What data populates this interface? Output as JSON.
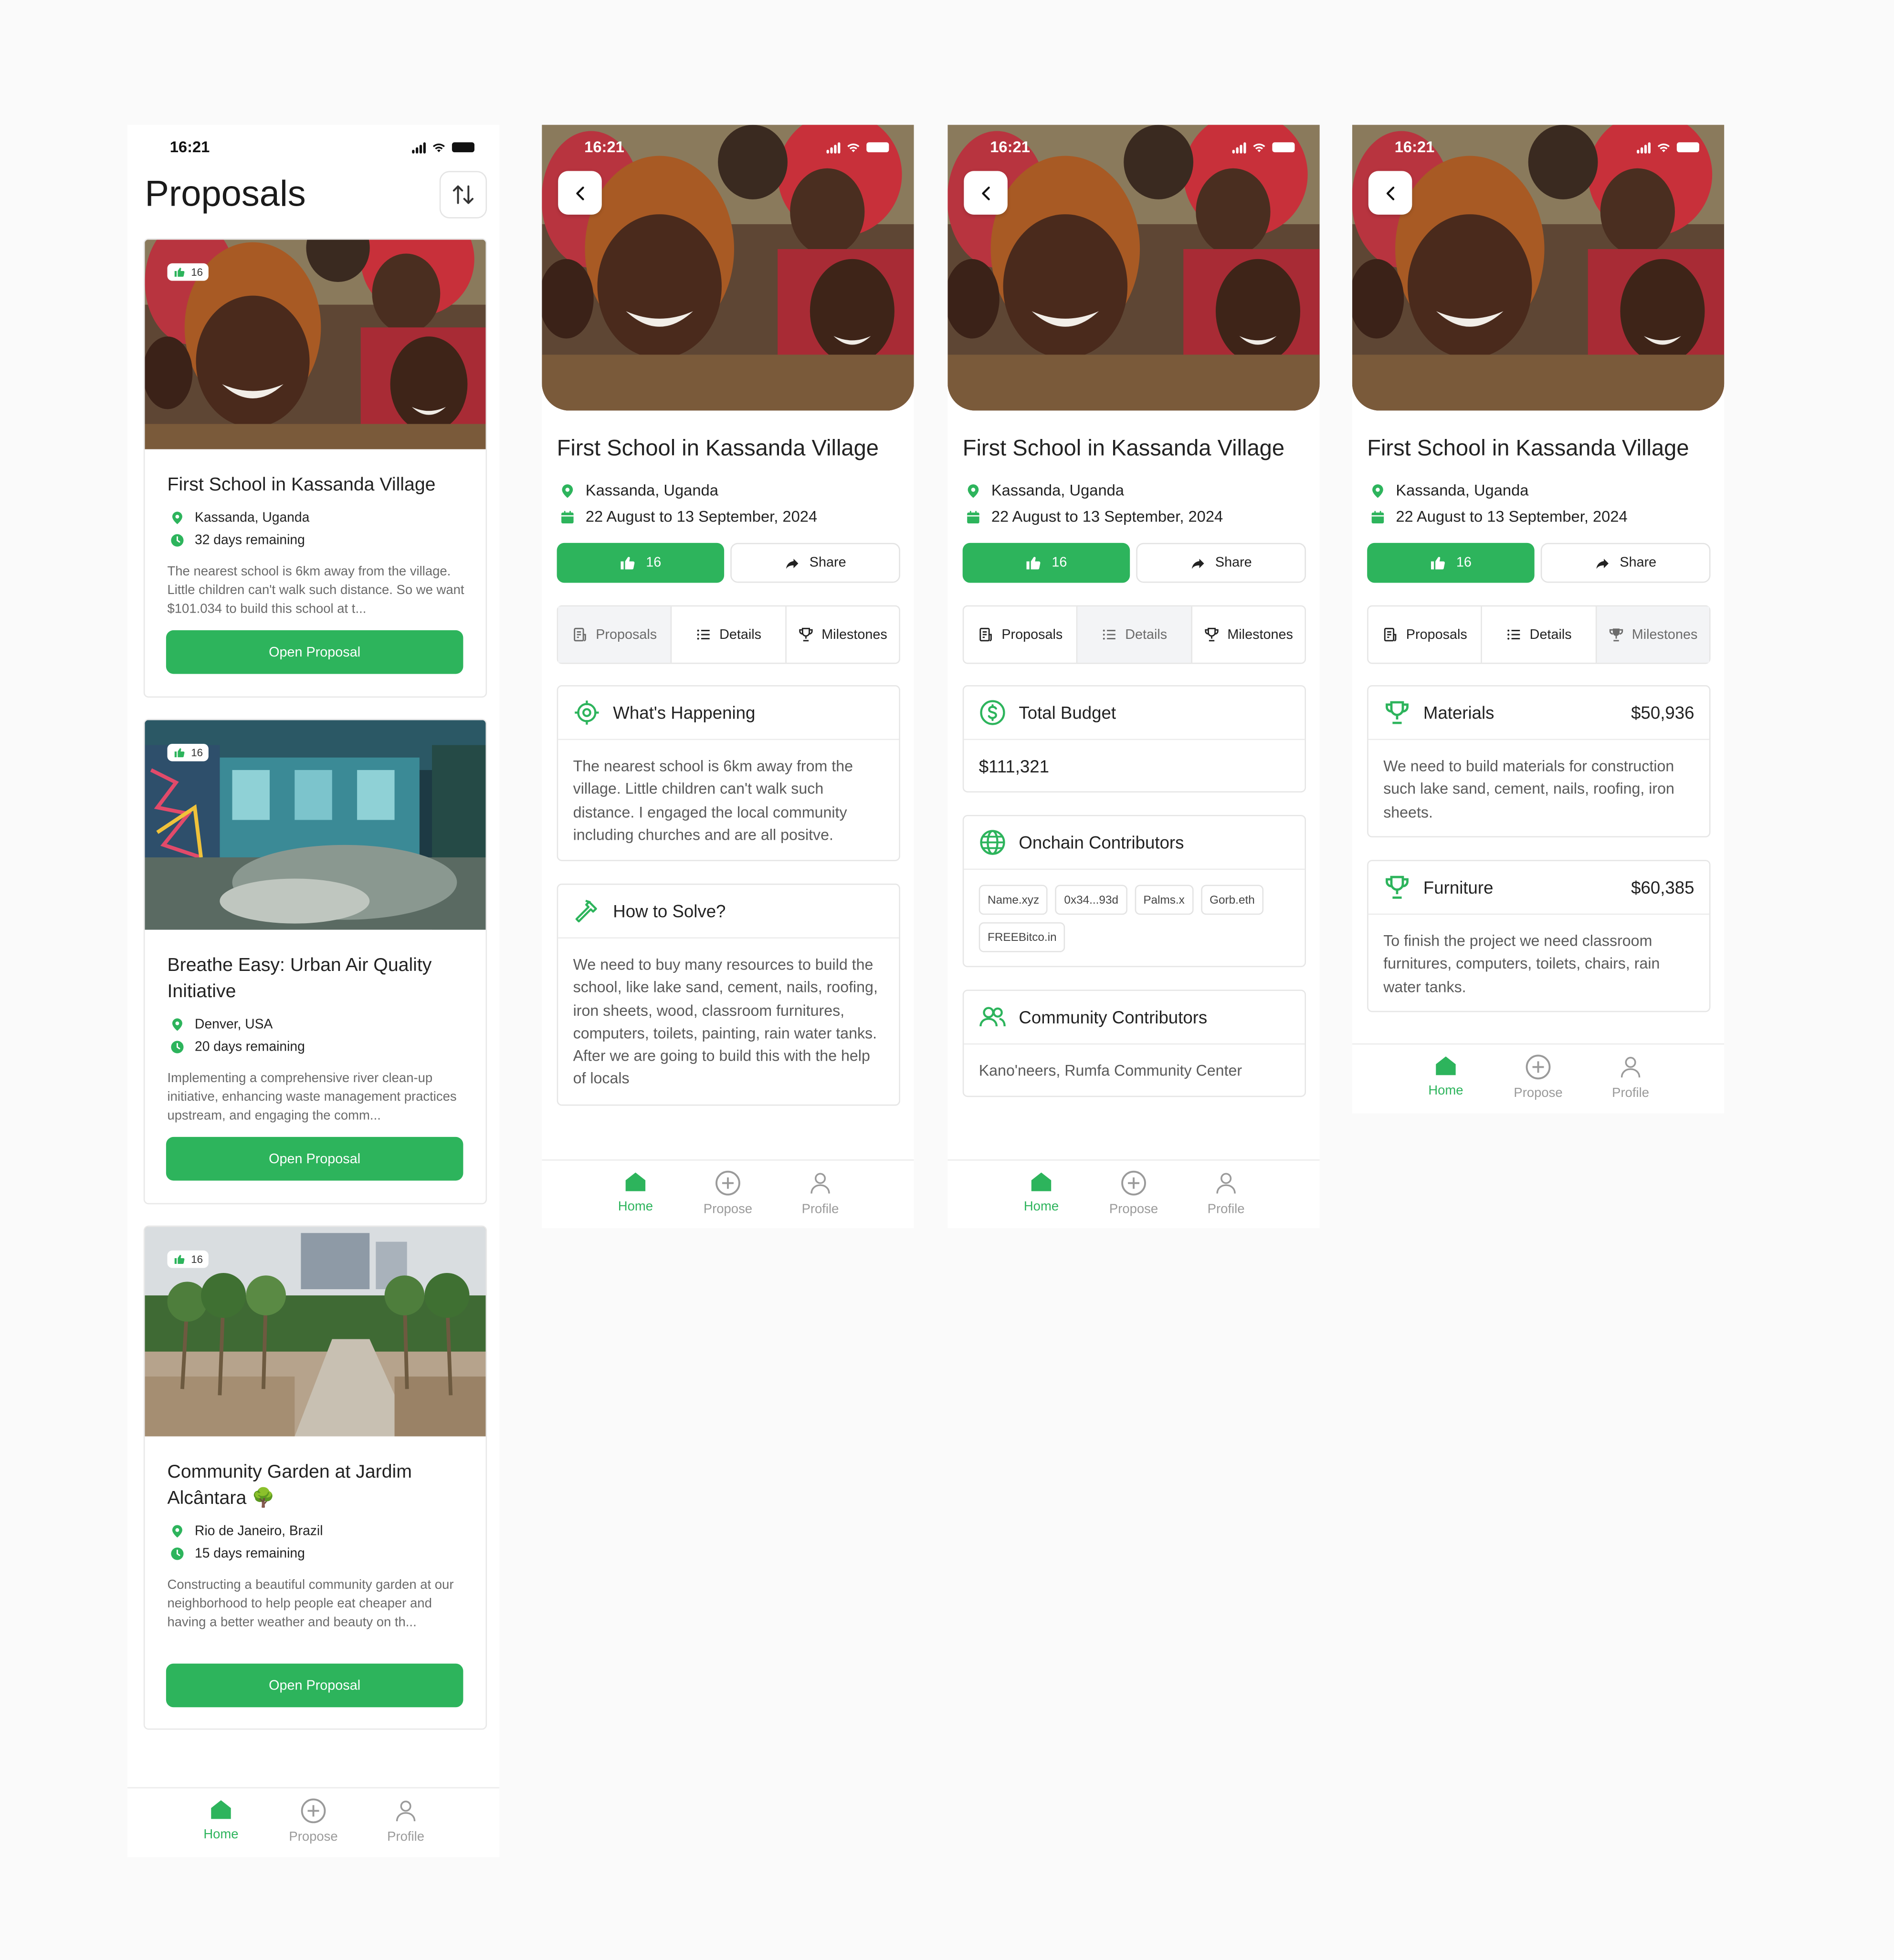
{
  "status": {
    "time": "16:21"
  },
  "list": {
    "title": "Proposals",
    "cards": [
      {
        "likes": "16",
        "title": "First School in Kassanda Village",
        "location": "Kassanda, Uganda",
        "remaining": "32 days remaining",
        "description": "The nearest school is 6km away from the village. Little children can't walk such distance. So we want $101.034 to build this school at t...",
        "button": "Open Proposal"
      },
      {
        "likes": "16",
        "title": "Breathe Easy: Urban Air Quality Initiative",
        "location": "Denver, USA",
        "remaining": "20 days remaining",
        "description": "Implementing a comprehensive river clean-up initiative, enhancing waste management practices upstream, and engaging the comm...",
        "button": "Open Proposal"
      },
      {
        "likes": "16",
        "title": "Community Garden at Jardim Alcântara 🌳",
        "location": "Rio de Janeiro, Brazil",
        "remaining": "15 days remaining",
        "description": "Constructing a beautiful community garden at our neighborhood to help people eat cheaper and having a better weather and beauty on th...",
        "button": "Open Proposal"
      }
    ]
  },
  "detail": {
    "title": "First School in Kassanda Village",
    "location": "Kassanda, Uganda",
    "dates": "22 August to 13 September, 2024",
    "likes": "16",
    "share": "Share",
    "tabs": {
      "proposals": "Proposals",
      "details": "Details",
      "milestones": "Milestones"
    }
  },
  "proposals_tab": {
    "happening_title": "What's Happening",
    "happening_text": "The nearest school is 6km away from the village. Little children can't walk such distance. I engaged the local community including churches and are all positve.",
    "solve_title": "How to Solve?",
    "solve_text": "We need to buy many resources to build the school, like lake sand, cement, nails, roofing, iron sheets, wood, classroom furnitures, computers, toilets, painting, rain water tanks. After we are going to build this with the help of locals"
  },
  "details_tab": {
    "budget_title": "Total Budget",
    "budget_value": "$111,321",
    "onchain_title": "Onchain Contributors",
    "onchain": [
      "Name.xyz",
      "0x34...93d",
      "Palms.x",
      "Gorb.eth",
      "FREEBitco.in"
    ],
    "community_title": "Community Contributors",
    "community_text": "Kano'neers, Rumfa Community Center"
  },
  "milestones_tab": {
    "items": [
      {
        "title": "Materials",
        "amount": "$50,936",
        "text": "We need to build materials for construction such lake sand, cement, nails, roofing, iron sheets."
      },
      {
        "title": "Furniture",
        "amount": "$60,385",
        "text": "To finish the project we need classroom furnitures, computers, toilets, chairs, rain water tanks."
      }
    ]
  },
  "nav": {
    "home": "Home",
    "propose": "Propose",
    "profile": "Profile"
  },
  "colors": {
    "accent": "#2db45c",
    "text": "#1c1c1c",
    "muted": "#6a6a6a",
    "border": "#e6e6e6"
  }
}
